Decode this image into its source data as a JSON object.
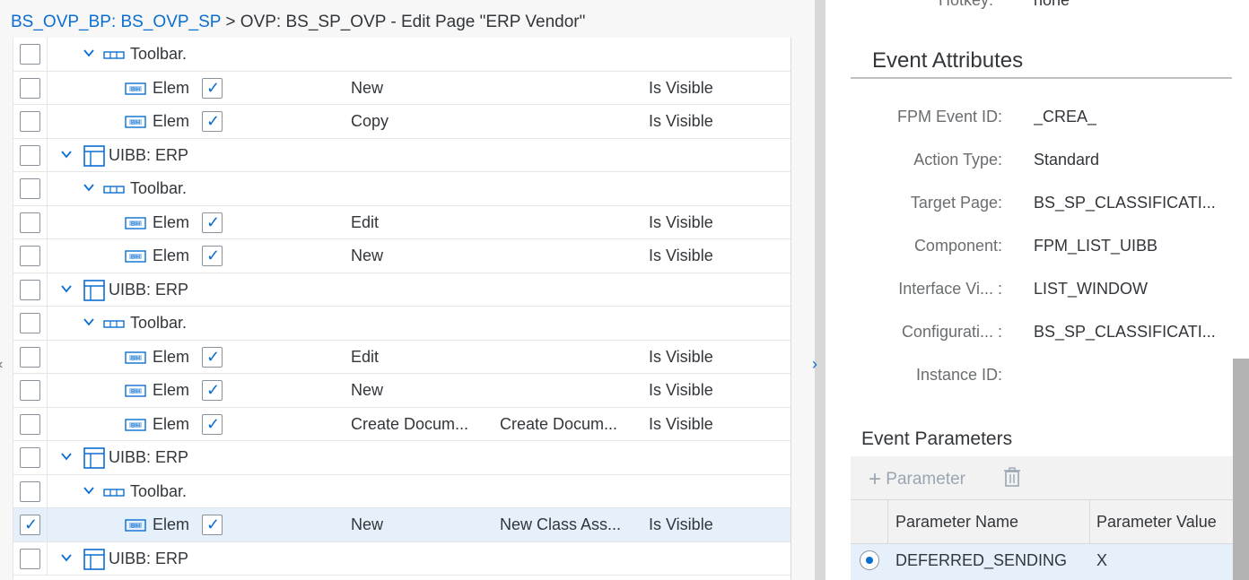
{
  "breadcrumb": {
    "link": "BS_OVP_BP: BS_OVP_SP",
    "separator": ">",
    "current": "OVP: BS_SP_OVP - Edit Page \"ERP Vendor\""
  },
  "tree_rows": [
    {
      "type": "toolbar",
      "label": "Toolbar.",
      "checked": false
    },
    {
      "type": "element",
      "label": "Elem",
      "event": "New",
      "text": "",
      "visibility": "Is Visible",
      "checked": false
    },
    {
      "type": "element",
      "label": "Elem",
      "event": "Copy",
      "text": "",
      "visibility": "Is Visible",
      "checked": false
    },
    {
      "type": "uibb",
      "label": "UIBB: ERP",
      "checked": false
    },
    {
      "type": "toolbar",
      "label": "Toolbar.",
      "checked": false
    },
    {
      "type": "element",
      "label": "Elem",
      "event": "Edit",
      "text": "",
      "visibility": "Is Visible",
      "checked": false
    },
    {
      "type": "element",
      "label": "Elem",
      "event": "New",
      "text": "",
      "visibility": "Is Visible",
      "checked": false
    },
    {
      "type": "uibb",
      "label": "UIBB: ERP",
      "checked": false
    },
    {
      "type": "toolbar",
      "label": "Toolbar.",
      "checked": false
    },
    {
      "type": "element",
      "label": "Elem",
      "event": "Edit",
      "text": "",
      "visibility": "Is Visible",
      "checked": false
    },
    {
      "type": "element",
      "label": "Elem",
      "event": "New",
      "text": "",
      "visibility": "Is Visible",
      "checked": false
    },
    {
      "type": "element",
      "label": "Elem",
      "event": "Create Docum...",
      "text": "Create Docum...",
      "visibility": "Is Visible",
      "checked": false
    },
    {
      "type": "uibb",
      "label": "UIBB: ERP",
      "checked": false
    },
    {
      "type": "toolbar",
      "label": "Toolbar.",
      "checked": false
    },
    {
      "type": "element",
      "label": "Elem",
      "event": "New",
      "text": "New Class Ass...",
      "visibility": "Is Visible",
      "checked": true,
      "selected": true
    },
    {
      "type": "uibb",
      "label": "UIBB: ERP",
      "checked": false
    }
  ],
  "right": {
    "hotkey_label": "Hotkey:",
    "hotkey_value": "none",
    "section_title": "Event Attributes",
    "fields": [
      {
        "label": "FPM Event ID:",
        "value": "_CREA_"
      },
      {
        "label": "Action Type:",
        "value": "Standard"
      },
      {
        "label": "Target Page:",
        "value": "BS_SP_CLASSIFICATI..."
      },
      {
        "label": "Component:",
        "value": "FPM_LIST_UIBB"
      },
      {
        "label": "Interface Vi... :",
        "value": "LIST_WINDOW"
      },
      {
        "label": "Configurati... :",
        "value": "BS_SP_CLASSIFICATI..."
      },
      {
        "label": "Instance ID:",
        "value": ""
      }
    ],
    "params_title": "Event Parameters",
    "add_param_label": "Parameter",
    "param_headers": {
      "name": "Parameter Name",
      "value": "Parameter Value"
    },
    "param_rows": [
      {
        "name": "DEFERRED_SENDING",
        "value": "X"
      }
    ]
  },
  "colors": {
    "link": "#0a6ed1",
    "selected_row": "#e5f0fa",
    "divider": "#d8d8d8"
  }
}
